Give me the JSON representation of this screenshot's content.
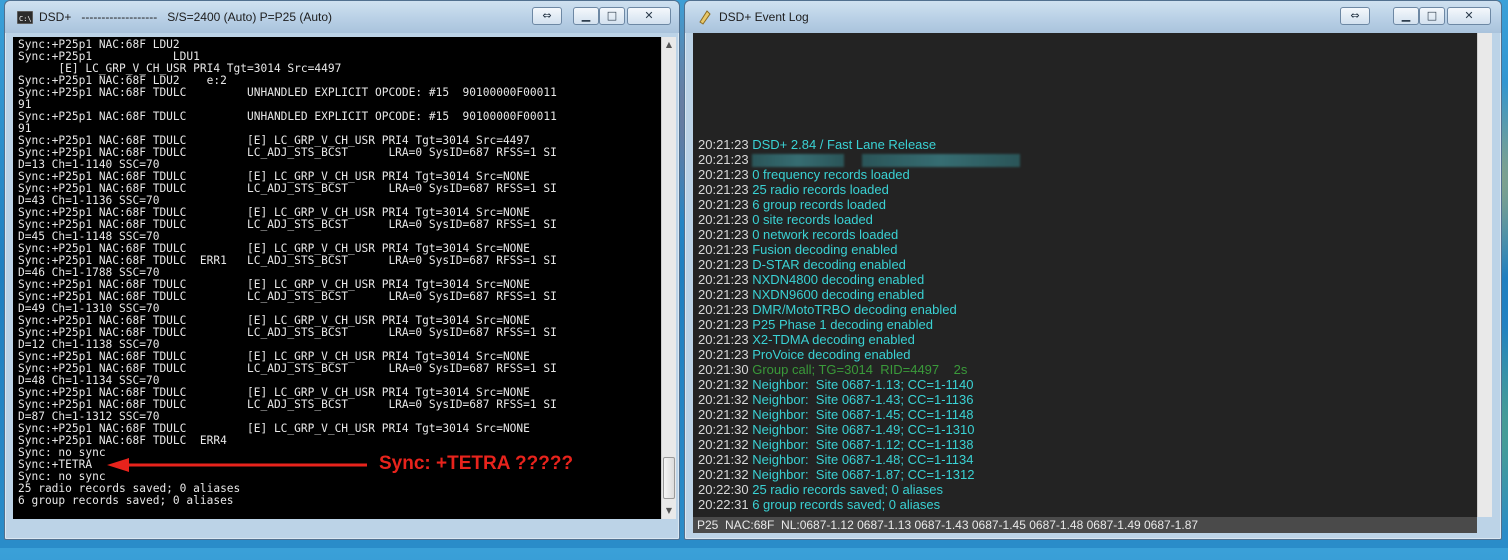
{
  "console_window": {
    "title": "DSD+   -------------------   S/S=2400 (Auto) P=P25 (Auto)",
    "icon_label": "C:\\",
    "lines": [
      "Sync:+P25p1 NAC:68F LDU2",
      "Sync:+P25p1            LDU1",
      "      [E] LC_GRP_V_CH_USR PRI4 Tgt=3014 Src=4497",
      "Sync:+P25p1 NAC:68F LDU2    e:2",
      "Sync:+P25p1 NAC:68F TDULC         UNHANDLED EXPLICIT OPCODE: #15  90100000F00011",
      "91",
      "Sync:+P25p1 NAC:68F TDULC         UNHANDLED EXPLICIT OPCODE: #15  90100000F00011",
      "91",
      "Sync:+P25p1 NAC:68F TDULC         [E] LC_GRP_V_CH_USR PRI4 Tgt=3014 Src=4497",
      "Sync:+P25p1 NAC:68F TDULC         LC_ADJ_STS_BCST      LRA=0 SysID=687 RFSS=1 SI",
      "D=13 Ch=1-1140 SSC=70",
      "Sync:+P25p1 NAC:68F TDULC         [E] LC_GRP_V_CH_USR PRI4 Tgt=3014 Src=NONE",
      "Sync:+P25p1 NAC:68F TDULC         LC_ADJ_STS_BCST      LRA=0 SysID=687 RFSS=1 SI",
      "D=43 Ch=1-1136 SSC=70",
      "Sync:+P25p1 NAC:68F TDULC         [E] LC_GRP_V_CH_USR PRI4 Tgt=3014 Src=NONE",
      "Sync:+P25p1 NAC:68F TDULC         LC_ADJ_STS_BCST      LRA=0 SysID=687 RFSS=1 SI",
      "D=45 Ch=1-1148 SSC=70",
      "Sync:+P25p1 NAC:68F TDULC         [E] LC_GRP_V_CH_USR PRI4 Tgt=3014 Src=NONE",
      "Sync:+P25p1 NAC:68F TDULC  ERR1   LC_ADJ_STS_BCST      LRA=0 SysID=687 RFSS=1 SI",
      "D=46 Ch=1-1788 SSC=70",
      "Sync:+P25p1 NAC:68F TDULC         [E] LC_GRP_V_CH_USR PRI4 Tgt=3014 Src=NONE",
      "Sync:+P25p1 NAC:68F TDULC         LC_ADJ_STS_BCST      LRA=0 SysID=687 RFSS=1 SI",
      "D=49 Ch=1-1310 SSC=70",
      "Sync:+P25p1 NAC:68F TDULC         [E] LC_GRP_V_CH_USR PRI4 Tgt=3014 Src=NONE",
      "Sync:+P25p1 NAC:68F TDULC         LC_ADJ_STS_BCST      LRA=0 SysID=687 RFSS=1 SI",
      "D=12 Ch=1-1138 SSC=70",
      "Sync:+P25p1 NAC:68F TDULC         [E] LC_GRP_V_CH_USR PRI4 Tgt=3014 Src=NONE",
      "Sync:+P25p1 NAC:68F TDULC         LC_ADJ_STS_BCST      LRA=0 SysID=687 RFSS=1 SI",
      "D=48 Ch=1-1134 SSC=70",
      "Sync:+P25p1 NAC:68F TDULC         [E] LC_GRP_V_CH_USR PRI4 Tgt=3014 Src=NONE",
      "Sync:+P25p1 NAC:68F TDULC         LC_ADJ_STS_BCST      LRA=0 SysID=687 RFSS=1 SI",
      "D=87 Ch=1-1312 SSC=70",
      "Sync:+P25p1 NAC:68F TDULC         [E] LC_GRP_V_CH_USR PRI4 Tgt=3014 Src=NONE",
      "Sync:+P25p1 NAC:68F TDULC  ERR4",
      "Sync: no sync",
      "Sync:+TETRA",
      "Sync: no sync",
      "25 radio records saved; 0 aliases",
      "6 group records saved; 0 aliases"
    ],
    "annotation": "Sync: +TETRA ?????",
    "annotation_color": "#e8231c"
  },
  "event_log_window": {
    "title": "DSD+ Event Log",
    "entries": [
      {
        "time": "20:21:23",
        "text": "DSD+ 2.84 / Fast Lane Release"
      },
      {
        "time": "20:21:23",
        "text": ""
      },
      {
        "time": "20:21:23",
        "text": "0 frequency records loaded"
      },
      {
        "time": "20:21:23",
        "text": "25 radio records loaded"
      },
      {
        "time": "20:21:23",
        "text": "6 group records loaded"
      },
      {
        "time": "20:21:23",
        "text": "0 site records loaded"
      },
      {
        "time": "20:21:23",
        "text": "0 network records loaded"
      },
      {
        "time": "20:21:23",
        "text": "Fusion decoding enabled"
      },
      {
        "time": "20:21:23",
        "text": "D-STAR decoding enabled"
      },
      {
        "time": "20:21:23",
        "text": "NXDN4800 decoding enabled"
      },
      {
        "time": "20:21:23",
        "text": "NXDN9600 decoding enabled"
      },
      {
        "time": "20:21:23",
        "text": "DMR/MotoTRBO decoding enabled"
      },
      {
        "time": "20:21:23",
        "text": "P25 Phase 1 decoding enabled"
      },
      {
        "time": "20:21:23",
        "text": "X2-TDMA decoding enabled"
      },
      {
        "time": "20:21:23",
        "text": "ProVoice decoding enabled"
      },
      {
        "time": "20:21:30",
        "text": "Group call; TG=3014  RID=4497    2s",
        "green": true
      },
      {
        "time": "20:21:32",
        "text": "Neighbor:  Site 0687-1.13; CC=1-1140"
      },
      {
        "time": "20:21:32",
        "text": "Neighbor:  Site 0687-1.43; CC=1-1136"
      },
      {
        "time": "20:21:32",
        "text": "Neighbor:  Site 0687-1.45; CC=1-1148"
      },
      {
        "time": "20:21:32",
        "text": "Neighbor:  Site 0687-1.49; CC=1-1310"
      },
      {
        "time": "20:21:32",
        "text": "Neighbor:  Site 0687-1.12; CC=1-1138"
      },
      {
        "time": "20:21:32",
        "text": "Neighbor:  Site 0687-1.48; CC=1-1134"
      },
      {
        "time": "20:21:32",
        "text": "Neighbor:  Site 0687-1.87; CC=1-1312"
      },
      {
        "time": "20:22:30",
        "text": "25 radio records saved; 0 aliases"
      },
      {
        "time": "20:22:31",
        "text": "6 group records saved; 0 aliases"
      }
    ],
    "status_bar": "P25  NAC:68F  NL:0687-1.12 0687-1.13 0687-1.43 0687-1.45 0687-1.48 0687-1.49 0687-1.87"
  },
  "colors": {
    "log_text": "#3ad2d4",
    "log_green": "#3a9a3a",
    "console_bg": "#000000",
    "log_bg": "#232323"
  }
}
